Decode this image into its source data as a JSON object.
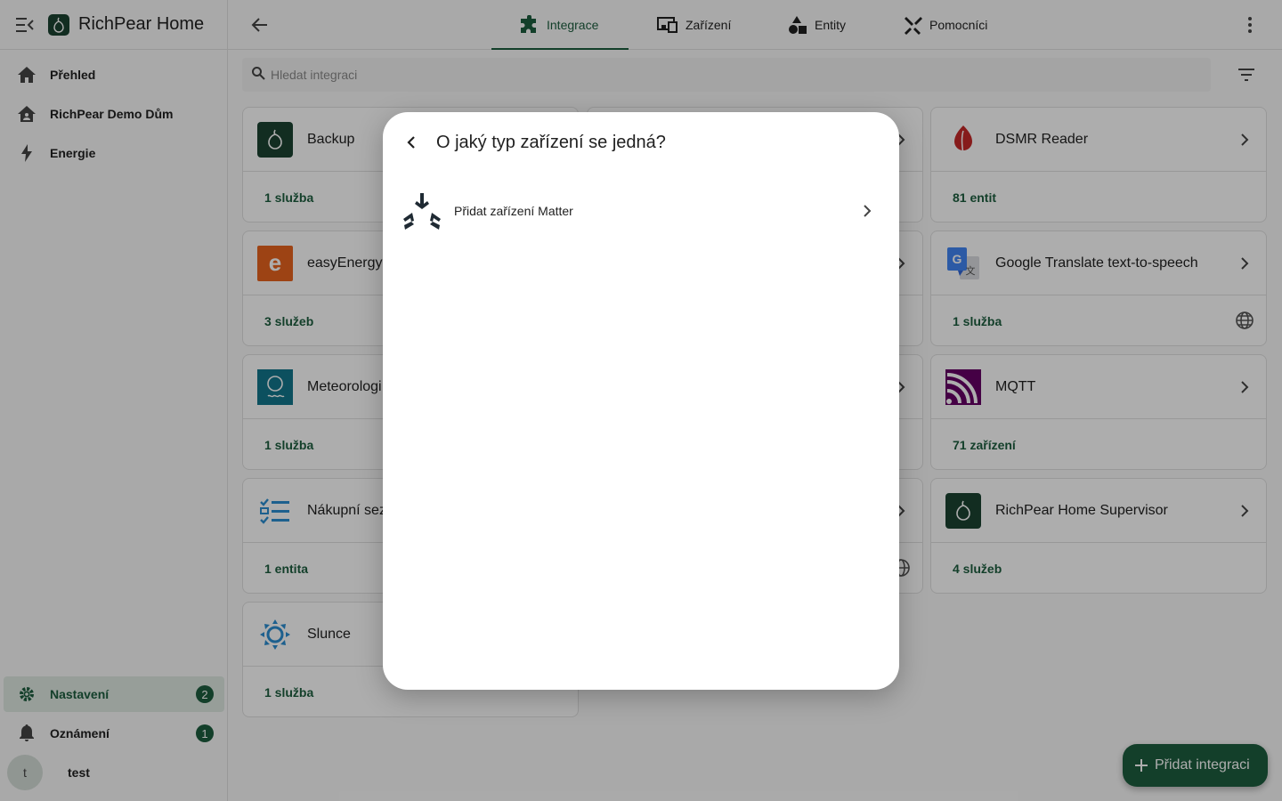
{
  "app": {
    "title": "RichPear Home"
  },
  "sidebar": {
    "items": [
      {
        "label": "Přehled",
        "icon": "home-icon"
      },
      {
        "label": "RichPear Demo Dům",
        "icon": "home-account-icon"
      },
      {
        "label": "Energie",
        "icon": "lightning-icon"
      }
    ],
    "settings": {
      "label": "Nastavení",
      "badge": "2"
    },
    "notifications": {
      "label": "Oznámení",
      "badge": "1"
    },
    "user": {
      "initial": "t",
      "name": "test"
    }
  },
  "tabs": [
    {
      "label": "Integrace",
      "icon": "puzzle-icon",
      "active": true
    },
    {
      "label": "Zařízení",
      "icon": "devices-icon",
      "active": false
    },
    {
      "label": "Entity",
      "icon": "shapes-icon",
      "active": false
    },
    {
      "label": "Pomocníci",
      "icon": "tools-icon",
      "active": false
    }
  ],
  "search": {
    "placeholder": "Hledat integraci",
    "value": ""
  },
  "cards": [
    {
      "name": "Backup",
      "link": "1 služba"
    },
    {
      "name": "DSMR Reader",
      "link": "81 entit"
    },
    {
      "name": "easyEnergy",
      "link": "3 služeb"
    },
    {
      "name": "Google Translate text-to-speech",
      "link": "1 služba"
    },
    {
      "name": "Meteorologi",
      "link": "1 služba"
    },
    {
      "name": "MQTT",
      "link": "71 zařízení"
    },
    {
      "name": "Nákupní sez",
      "link": "1 entita"
    },
    {
      "name": "RichPear Home Supervisor",
      "link": "4 služeb"
    },
    {
      "name": "Slunce",
      "link": "1 služba"
    }
  ],
  "dialog": {
    "title": "O jaký typ zařízení se jedná?",
    "items": [
      {
        "label": "Přidat zařízení Matter",
        "icon": "matter-icon"
      }
    ]
  },
  "fab": {
    "label": "Přidat integraci"
  },
  "colors": {
    "primary": "#1d5e3f",
    "accent_orange": "#e8641e",
    "mqtt": "#660066",
    "google_blue": "#4285f4",
    "sun_blue": "#2b8ed1"
  }
}
